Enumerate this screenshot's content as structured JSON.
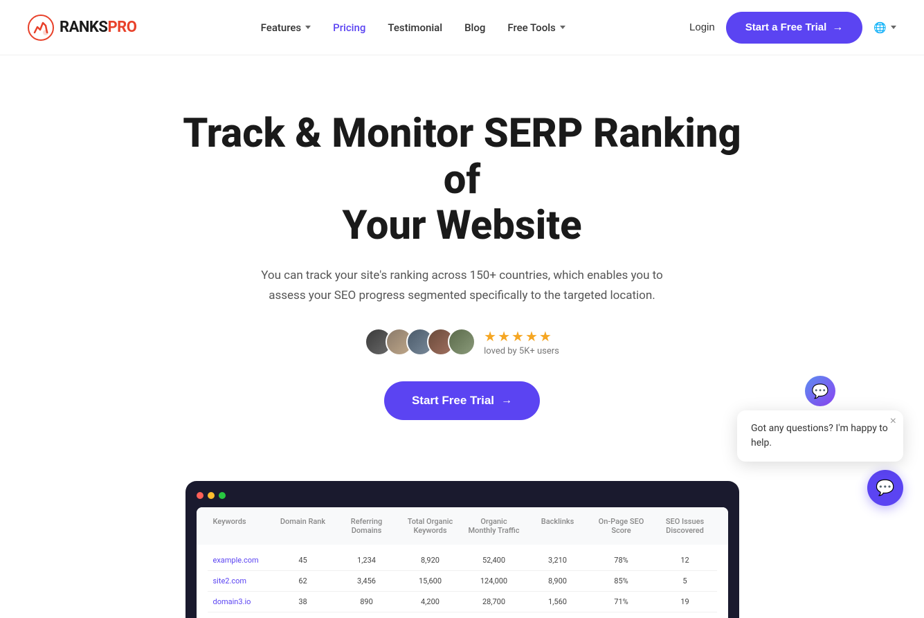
{
  "logo": {
    "ranks": "RANKS",
    "pro": "PRO",
    "icon_label": "rankspro-logo-icon"
  },
  "nav": {
    "features_label": "Features",
    "pricing_label": "Pricing",
    "testimonial_label": "Testimonial",
    "blog_label": "Blog",
    "free_tools_label": "Free Tools",
    "login_label": "Login",
    "trial_button_label": "Start a Free Trial",
    "globe_label": "EN"
  },
  "hero": {
    "title_line1": "Track & Monitor SERP Ranking of",
    "title_line2": "Your Website",
    "subtitle": "You can track your site's ranking across 150+ countries, which enables you to assess your SEO progress segmented specifically to the targeted location.",
    "cta_label": "Start Free Trial",
    "loved_text": "loved by 5K+ users"
  },
  "stars": [
    "★",
    "★",
    "★",
    "★",
    "★"
  ],
  "avatars": [
    {
      "label": "A1",
      "class": "avatar-1"
    },
    {
      "label": "A2",
      "class": "avatar-2"
    },
    {
      "label": "A3",
      "class": "avatar-3"
    },
    {
      "label": "A4",
      "class": "avatar-4"
    },
    {
      "label": "A5",
      "class": "avatar-5"
    }
  ],
  "preview": {
    "columns": [
      "Keywords",
      "Domain Rank",
      "Referring Domains",
      "Total Organic Keywords",
      "Organic Monthly Traffic",
      "Backlinks",
      "On-Page SEO Score",
      "SEO Issues Discovered"
    ],
    "rows": [
      [
        "example.com",
        "45",
        "1,234",
        "8,920",
        "52,400",
        "3,210",
        "78%",
        "12"
      ],
      [
        "site2.com",
        "62",
        "3,456",
        "15,600",
        "124,000",
        "8,900",
        "85%",
        "5"
      ],
      [
        "domain3.io",
        "38",
        "890",
        "4,200",
        "28,700",
        "1,560",
        "71%",
        "19"
      ]
    ]
  },
  "chat": {
    "bubble_text": "Got any questions? I'm happy to help.",
    "close_label": "×"
  },
  "colors": {
    "brand_purple": "#5b44f2",
    "brand_red": "#e8412a",
    "star_gold": "#f5a623"
  }
}
